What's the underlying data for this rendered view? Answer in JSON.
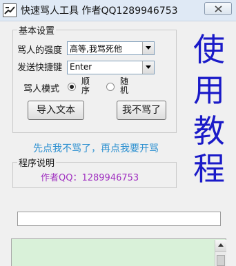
{
  "window": {
    "title": "快速骂人工具 作者QQ1289946753",
    "close_icon": "close-x-icon"
  },
  "settings": {
    "group_label": "基本设置",
    "intensity_label": "骂人的强度",
    "intensity_value": "高等,我骂死他",
    "send_key_label": "发送快捷键",
    "send_key_value": "Enter",
    "mode_label": "骂人模式",
    "mode_options": [
      {
        "label": "顺序",
        "selected": true
      },
      {
        "label": "随机",
        "selected": false
      }
    ],
    "import_button": "导入文本",
    "stop_button": "我不骂了"
  },
  "tutorial": {
    "chars": [
      "使",
      "用",
      "教",
      "程"
    ],
    "color": "#1a1ac8"
  },
  "hint": {
    "text": "先点我不骂了，再点我要开骂",
    "color": "#2a8fd0"
  },
  "program_info": {
    "group_label": "程序说明",
    "author_text": "作者QQ：1289946753",
    "color": "#a030c0"
  },
  "input": {
    "value": ""
  },
  "log": {
    "background": "#d9f1d9"
  }
}
